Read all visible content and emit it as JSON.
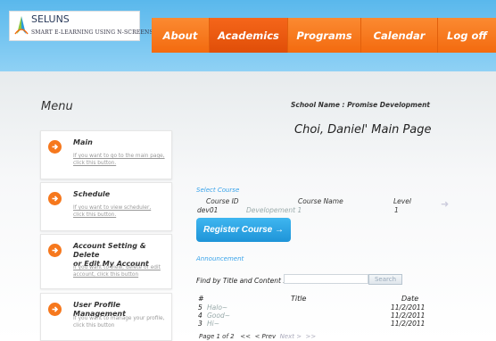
{
  "app": {
    "logo_title": "SELUNS",
    "logo_sub": "SMART E-LEARNING USING N-SCREENS"
  },
  "nav": {
    "items": [
      "About",
      "Academics",
      "Programs",
      "Calendar",
      "Log off"
    ]
  },
  "menu": {
    "title": "Menu",
    "cards": [
      {
        "title": "Main",
        "desc": "If you want to go to the main page, click this button."
      },
      {
        "title": "Schedule",
        "desc": "If you want to view scheduler, click this button."
      },
      {
        "title_line1": "Account Setting & Delete",
        "title_line2": "or Edit My Account",
        "desc": "If you want to view, delete or edit account, click this button"
      },
      {
        "title": "User Profile Management",
        "desc": "If you want to manage your profile, click this button"
      }
    ]
  },
  "main": {
    "school_name": "School Name : Promise Development",
    "title": "Choi, Daniel' Main Page",
    "select_course": {
      "label": "Select Course",
      "headers": {
        "id": "Course ID",
        "name": "Course Name",
        "level": "Level"
      },
      "rows": [
        {
          "id": "dev01",
          "name": "Developement 1",
          "level": "1"
        }
      ]
    },
    "register_button": "Register Course →",
    "announcement": {
      "label": "Announcement",
      "find_label": "Find by Title and Content :",
      "find_value": "",
      "search_button": "Search",
      "headers": {
        "num": "#",
        "title": "Title",
        "date": "Date"
      },
      "rows": [
        {
          "num": "5",
          "title": "Halo~",
          "date": "11/2/2011"
        },
        {
          "num": "4",
          "title": "Good~",
          "date": "11/2/2011"
        },
        {
          "num": "3",
          "title": "Hi~",
          "date": "11/2/2011"
        }
      ],
      "pager": {
        "page_text": "Page 1 of 2",
        "first": "<<",
        "prev": "< Prev",
        "next": "Next >",
        "last": ">>"
      }
    }
  },
  "colors": {
    "nav_orange": "#f6781d",
    "accent_blue": "#39a3ea",
    "band_blue": "#5ab8ec"
  }
}
